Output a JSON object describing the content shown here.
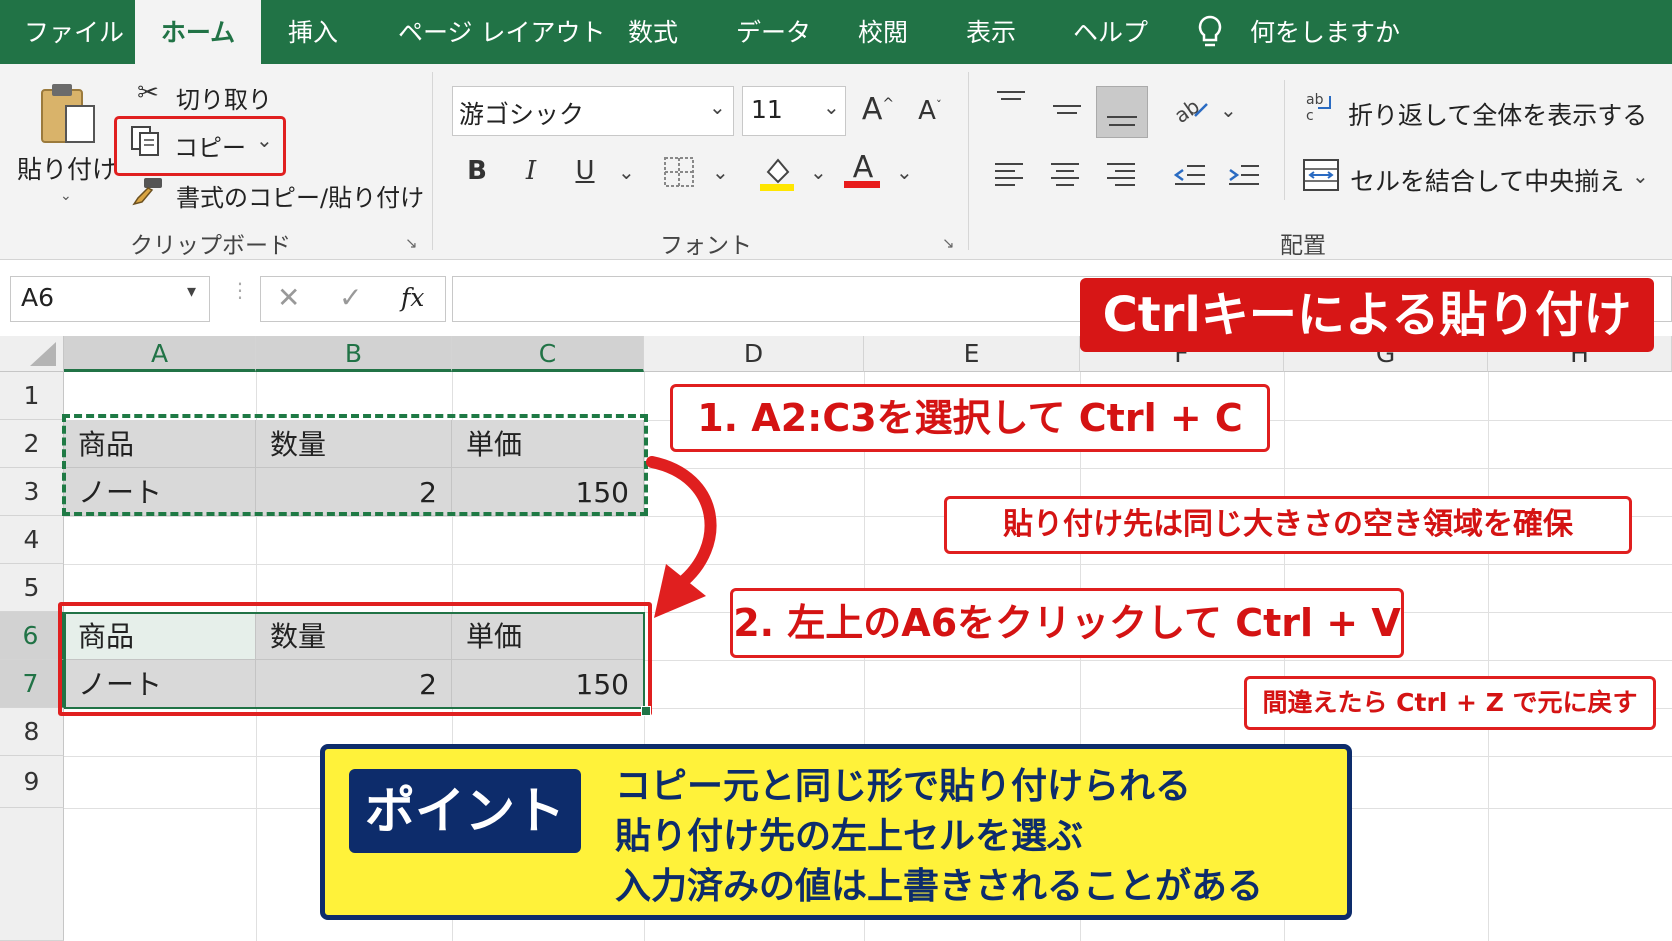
{
  "ribbon_tabs": [
    "ファイル",
    "ホーム",
    "挿入",
    "ページ レイアウト",
    "数式",
    "データ",
    "校閲",
    "表示",
    "ヘルプ"
  ],
  "tell_me": "何をしますか",
  "clipboard": {
    "paste": "貼り付け",
    "cut": "切り取り",
    "copy": "コピー",
    "format_painter": "書式のコピー/貼り付け",
    "group": "クリップボード"
  },
  "font": {
    "name": "游ゴシック",
    "size": "11",
    "bold": "B",
    "italic": "I",
    "underline": "U",
    "font_color": "A",
    "group": "フォント"
  },
  "alignment": {
    "wrap_text": "折り返して全体を表示する",
    "merge_center": "セルを結合して中央揃え",
    "group": "配置"
  },
  "formula_bar": {
    "name_box": "A6",
    "fx": "fx",
    "value": ""
  },
  "columns": [
    "A",
    "B",
    "C",
    "D",
    "E",
    "F",
    "G",
    "H"
  ],
  "rows": [
    "1",
    "2",
    "3",
    "4",
    "5",
    "6",
    "7",
    "8",
    "9"
  ],
  "source_table": [
    [
      "商品",
      "数量",
      "単価"
    ],
    [
      "ノート",
      "2",
      "150"
    ]
  ],
  "pasted_table": [
    [
      "商品",
      "数量",
      "単価"
    ],
    [
      "ノート",
      "2",
      "150"
    ]
  ],
  "annotations": {
    "title": "Ctrlキーによる貼り付け",
    "step1": "1. A2:C3を選択して Ctrl + C",
    "note1": "貼り付け先は同じ大きさの空き領域を確保",
    "step2": "2. 左上のA6をクリックして Ctrl + V",
    "note2": "間違えたら Ctrl + Z で元に戻す"
  },
  "point": {
    "label": "ポイント",
    "lines": [
      "コピー元と同じ形で貼り付けられる",
      "貼り付け先の左上セルを選ぶ",
      "入力済みの値は上書きされることがある"
    ]
  },
  "colors": {
    "excel_green": "#217346",
    "highlight_red": "#e01f1f",
    "point_yellow": "#fff23a",
    "point_navy": "#0d2c6b"
  }
}
